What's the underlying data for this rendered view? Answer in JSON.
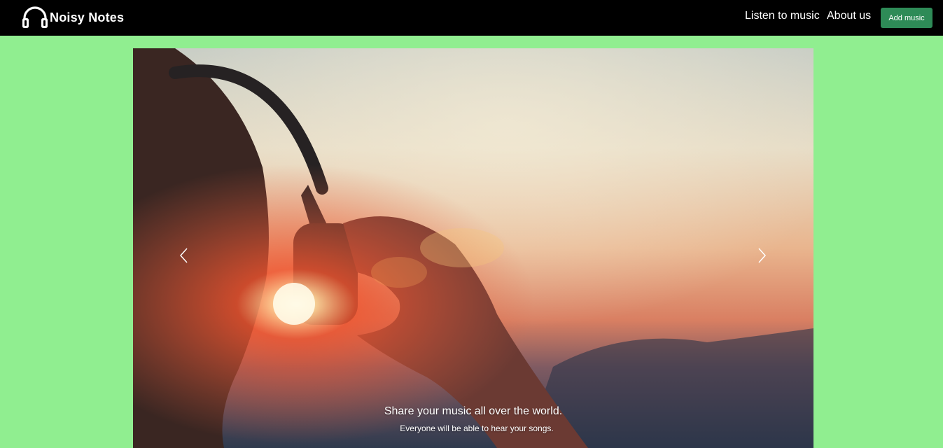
{
  "navbar": {
    "brand_name": "Noisy Notes",
    "brand_icon": "headphones-icon",
    "links": [
      "Listen to music",
      "About us"
    ],
    "add_button_label": "Add music",
    "colors": {
      "background": "#000000",
      "button": "#2e8b57"
    }
  },
  "page": {
    "background_color": "#90ee90"
  },
  "carousel": {
    "image": "person-with-headphones-at-sunset",
    "prev_icon": "chevron-left-icon",
    "next_icon": "chevron-right-icon",
    "caption_title": "Share your music all over the world.",
    "caption_text": "Everyone will be able to hear your songs."
  }
}
